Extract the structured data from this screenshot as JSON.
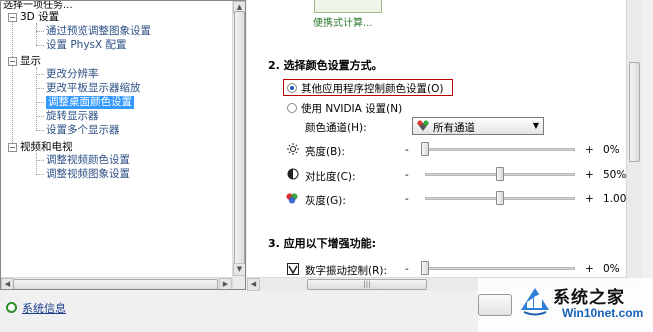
{
  "tree": {
    "header": "选择一项任务...",
    "categories": [
      {
        "label": "3D 设置",
        "items": [
          "通过预览调整图象设置",
          "设置 PhysX 配置"
        ]
      },
      {
        "label": "显示",
        "items": [
          "更改分辨率",
          "更改平板显示器缩放",
          "调整桌面颜色设置",
          "旋转显示器",
          "设置多个显示器"
        ]
      },
      {
        "label": "视频和电视",
        "items": [
          "调整视频颜色设置",
          "调整视频图象设置"
        ]
      }
    ],
    "selected_item": "调整桌面颜色设置"
  },
  "system_info_link": "系统信息",
  "banner": {
    "label": "便携式计算..."
  },
  "section2": {
    "title": "2. 选择颜色设置方式。",
    "radio_other_app": "其他应用程序控制颜色设置(O)",
    "radio_nvidia": "使用 NVIDIA 设置(N)",
    "selected_radio": "其他应用程序控制颜色设置(O)",
    "channel_label": "颜色通道(H):",
    "channel_value": "所有通道",
    "sliders": [
      {
        "label": "亮度(B):",
        "minus": "-",
        "plus": "+",
        "value": "0%",
        "level": 0.0
      },
      {
        "label": "对比度(C):",
        "minus": "-",
        "plus": "+",
        "value": "50%",
        "level": 0.5
      },
      {
        "label": "灰度(G):",
        "minus": "-",
        "plus": "+",
        "value": "1.00",
        "level": 0.5
      }
    ]
  },
  "section3": {
    "title": "3. 应用以下增强功能:",
    "slider": {
      "label": "数字振动控制(R):",
      "minus": "-",
      "plus": "+",
      "value": "0%",
      "level": 0.0
    }
  },
  "watermark": {
    "title": "系统之家",
    "url": "Win10net.com"
  },
  "colors": {
    "accent": "#1a5fb4",
    "selection": "#3399ff",
    "highlight_border": "#c00000",
    "link": "#1b3f91"
  }
}
